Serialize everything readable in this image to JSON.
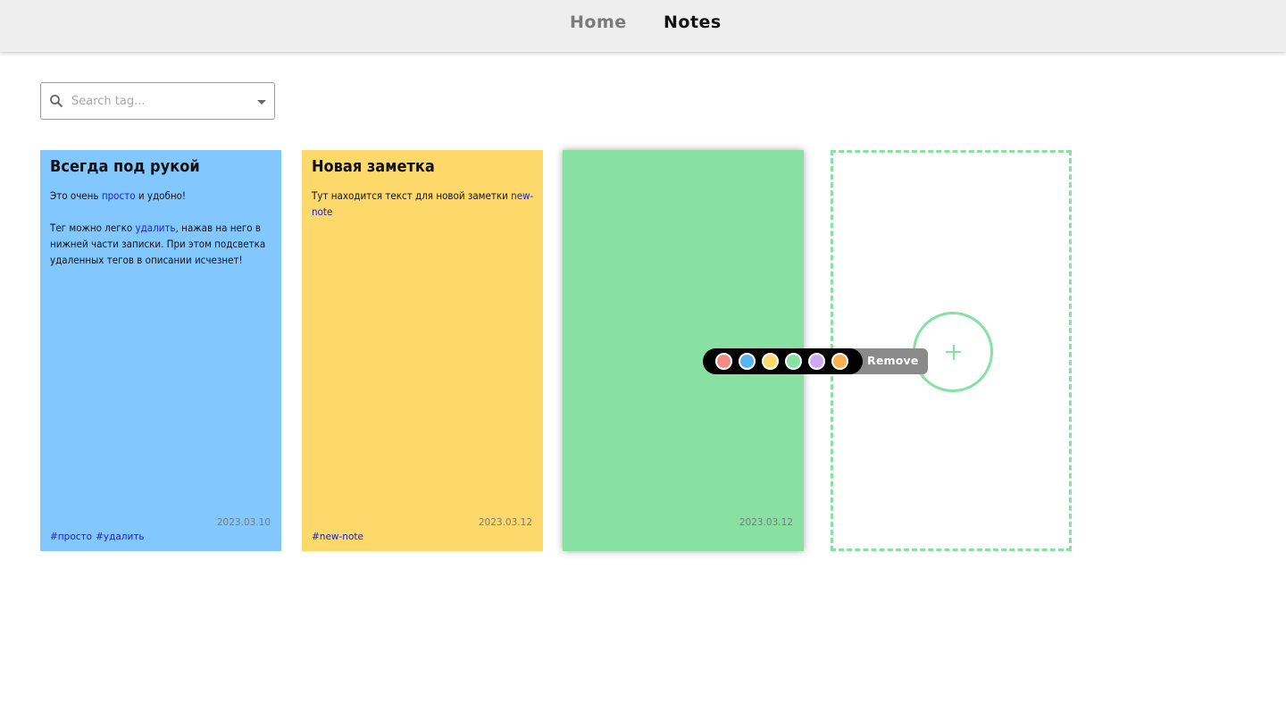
{
  "nav": {
    "home_label": "Home",
    "notes_label": "Notes"
  },
  "search": {
    "placeholder": "Search tag...",
    "icon": "search-icon"
  },
  "notes": [
    {
      "color": "#82c8ff",
      "title": "Всегда под рукой",
      "body": [
        [
          "Это очень ",
          "просто",
          " и удобно!"
        ],
        [
          "Тег можно легко ",
          "удалить",
          ", нажав на него в нижней части записки. При этом подсветка удаленных тегов в описании исчезнет!"
        ]
      ],
      "date": "2023.03.10",
      "tags": [
        "#просто",
        "#удалить"
      ]
    },
    {
      "color": "#fdd86a",
      "title": "Новая заметка",
      "body": [
        [
          "Тут находится текст для новой заметки ",
          "new-note",
          ""
        ]
      ],
      "date": "2023.03.12",
      "tags": [
        "#new-note"
      ]
    },
    {
      "color": "#88e0a2",
      "title": "",
      "body": [],
      "date": "2023.03.12",
      "tags": []
    }
  ],
  "color_menu": {
    "swatches": [
      "#f28b82",
      "#5ab2f0",
      "#fdd86a",
      "#88e0a2",
      "#cfa8f5",
      "#f8b04e"
    ],
    "remove_label": "Remove"
  },
  "add_note": {
    "icon": "plus-icon",
    "accent": "#88e0a2"
  }
}
